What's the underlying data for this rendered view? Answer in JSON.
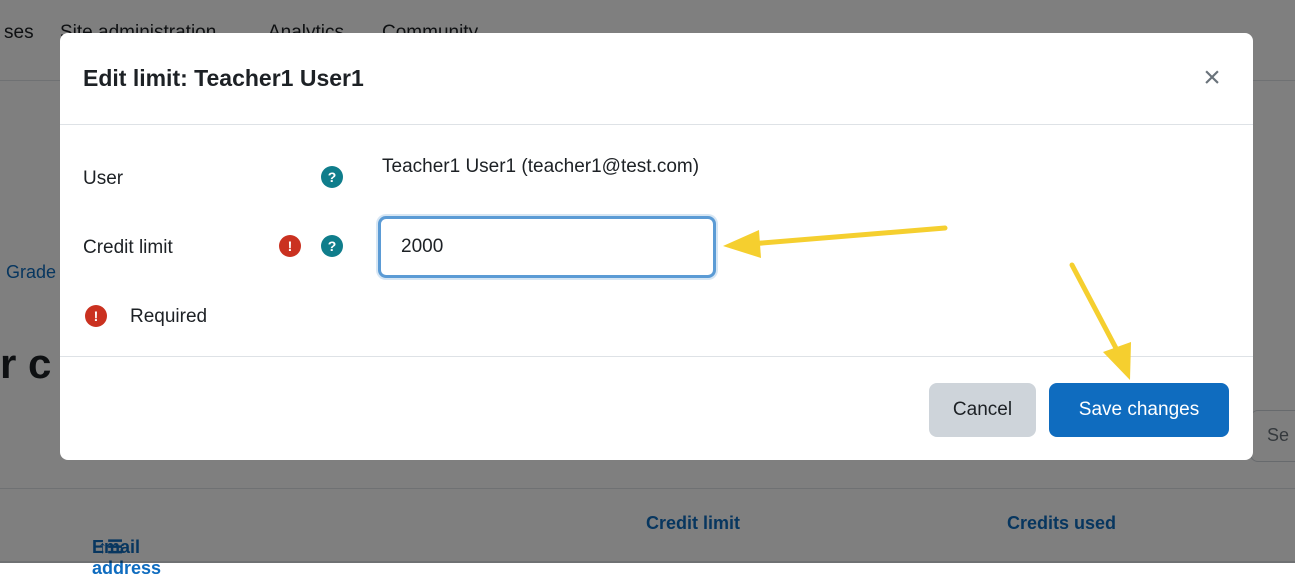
{
  "background": {
    "nav_items": [
      "ses",
      "Site administration",
      "Analytics",
      "Community"
    ],
    "grade_link": "Grade",
    "heading_fragment": "r c",
    "search_fragment": "Se",
    "table_headers": {
      "email": "Email address",
      "credit_limit": "Credit limit",
      "credits_used": "Credits used"
    }
  },
  "modal": {
    "title": "Edit limit: Teacher1 User1",
    "close_symbol": "×",
    "fields": {
      "user_label": "User",
      "user_value": "Teacher1 User1 (teacher1@test.com)",
      "credit_label": "Credit limit",
      "credit_value": "2000"
    },
    "required_text": "Required",
    "help_symbol": "?",
    "required_symbol": "!",
    "buttons": {
      "cancel": "Cancel",
      "save": "Save changes"
    }
  },
  "colors": {
    "primary": "#0f6cbf",
    "required": "#ca3120",
    "help": "#0f7d8b",
    "annotation_arrow": "#f5cf2f"
  }
}
